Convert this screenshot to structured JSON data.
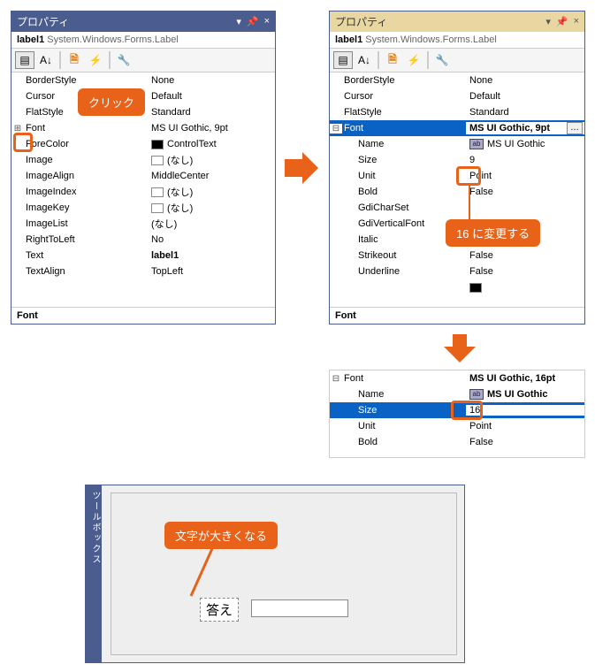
{
  "titles": {
    "properties": "プロパティ"
  },
  "object": {
    "name": "label1",
    "type": "System.Windows.Forms.Label"
  },
  "toolbar": {
    "cat": "▤",
    "az": "A↓",
    "page": "🗎",
    "bolt": "⚡",
    "wrench": "🔧"
  },
  "left": {
    "BorderStyle": "None",
    "Cursor": "Default",
    "FlatStyle": "Standard",
    "Font": "MS UI Gothic, 9pt",
    "ForeColor": "ControlText",
    "Image": "(なし)",
    "ImageAlign": "MiddleCenter",
    "ImageIndex": "(なし)",
    "ImageKey": "(なし)",
    "ImageList": "(なし)",
    "RightToLeft": "No",
    "Text": "label1",
    "TextAlign": "TopLeft"
  },
  "right": {
    "BorderStyle": "None",
    "Cursor": "Default",
    "FlatStyle": "Standard",
    "Font": "MS UI Gothic, 9pt",
    "Name": "MS UI Gothic",
    "Size": "9",
    "Unit": "Point",
    "Bold": "False",
    "GdiCharSet": "",
    "GdiVerticalFont": "",
    "Italic": "False",
    "Strikeout": "False",
    "Underline": "False"
  },
  "bottom": {
    "Font": "MS UI Gothic, 16pt",
    "Name": "MS UI Gothic",
    "Size": "16",
    "Unit": "Point",
    "Bold": "False"
  },
  "footer": "Font",
  "callouts": {
    "click": "クリック",
    "change16": "16 に変更する",
    "bigger": "文字が大きくなる"
  },
  "icons": {
    "dropdown": "▾",
    "pin": "📌",
    "close": "×",
    "plus": "⊞",
    "minus": "⊟",
    "ab": "ab",
    "ell": "…"
  },
  "design": {
    "sidebar": "ツールボックス",
    "label": "答え"
  }
}
